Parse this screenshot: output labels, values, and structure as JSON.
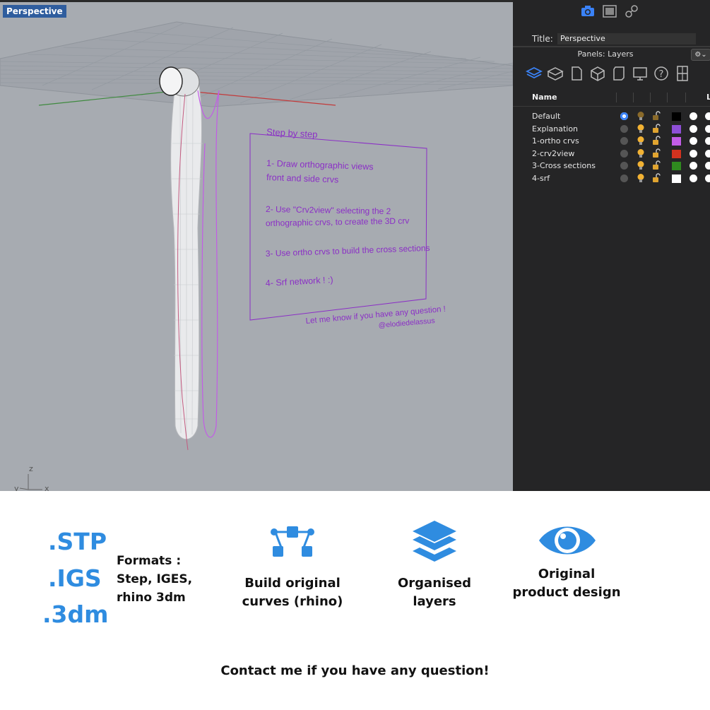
{
  "viewport": {
    "title": "Perspective",
    "axis_labels": {
      "z": "z",
      "y": "y",
      "x": "x"
    },
    "note": {
      "title": "Step by step",
      "step1_line1": "1- Draw orthographic views",
      "step1_line2": "front and side crvs",
      "step2_line1": "2- Use \"Crv2view\" selecting the 2",
      "step2_line2": "orthographic crvs, to create the 3D crv",
      "step3": "3- Use ortho crvs to build the cross sections",
      "step4": "4- Srf network ! :)",
      "footer1": "Let me know if you have any question !",
      "footer2": "@elodiedelassus"
    }
  },
  "panel": {
    "title_label": "Title:",
    "title_value": "Perspective",
    "panels_label": "Panels: Layers",
    "gear_label": "⚙⌄",
    "column_name": "Name",
    "column_l": "L",
    "layers": [
      {
        "name": "Default",
        "color": "#000000",
        "current": true
      },
      {
        "name": "Explanation",
        "color": "#8e4fd6",
        "current": false
      },
      {
        "name": "1-ortho crvs",
        "color": "#c25ce6",
        "current": false
      },
      {
        "name": "2-crv2view",
        "color": "#d2321f",
        "current": false
      },
      {
        "name": "3-Cross sections",
        "color": "#2f8a1f",
        "current": false
      },
      {
        "name": "4-srf",
        "color": "#ffffff",
        "current": false
      }
    ]
  },
  "bottom": {
    "formats": [
      ".STP",
      ".IGS",
      ".3dm"
    ],
    "formats_title": "Formats :",
    "formats_line2": "Step, IGES,",
    "formats_line3": "rhino 3dm",
    "feature1_line1": "Build original",
    "feature1_line2": "curves (rhino)",
    "feature2_line1": "Organised",
    "feature2_line2": "layers",
    "feature3_line1": "Original",
    "feature3_line2": "product design",
    "contact": "Contact me if you have any question!",
    "accent_color": "#2f8ce0"
  }
}
